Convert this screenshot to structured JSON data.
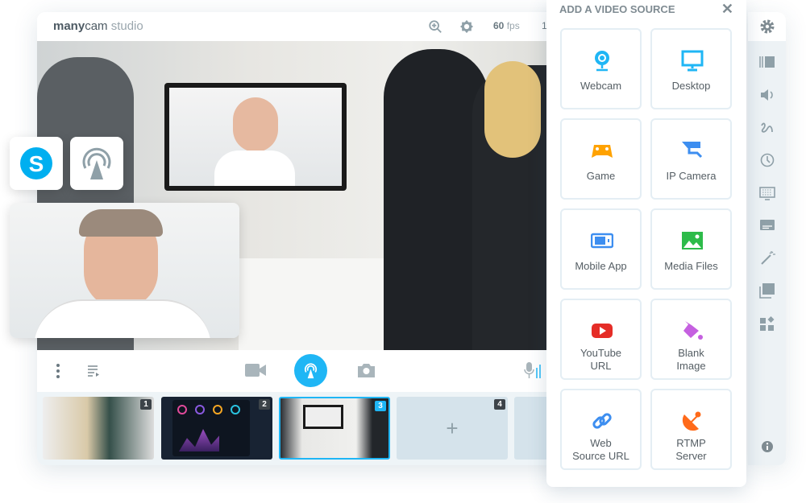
{
  "header": {
    "logo_bold": "many",
    "logo_mid": "cam",
    "logo_light": " studio",
    "fps_value": "60",
    "fps_unit": " fps",
    "resolution_partial": "1"
  },
  "panel": {
    "title": "ADD A VIDEO SOURCE",
    "close": "✕",
    "sources": [
      {
        "label": "Webcam",
        "icon": "webcam-icon",
        "color": "#1fb6f5"
      },
      {
        "label": "Desktop",
        "icon": "desktop-icon",
        "color": "#1fb6f5"
      },
      {
        "label": "Game",
        "icon": "gamepad-icon",
        "color": "#ffa200"
      },
      {
        "label": "IP Camera",
        "icon": "ip-camera-icon",
        "color": "#3d8ef0"
      },
      {
        "label": "Mobile App",
        "icon": "mobile-app-icon",
        "color": "#3d8ef0"
      },
      {
        "label": "Media Files",
        "icon": "image-icon",
        "color": "#2dbb4a"
      },
      {
        "label": "YouTube\nURL",
        "l1": "YouTube",
        "l2": "URL",
        "icon": "youtube-icon",
        "color": "#e52d27"
      },
      {
        "label": "Blank\nImage",
        "l1": "Blank",
        "l2": "Image",
        "icon": "paint-bucket-icon",
        "color": "#c560e0"
      },
      {
        "label": "Web\nSource URL",
        "l1": "Web",
        "l2": "Source URL",
        "icon": "link-icon",
        "color": "#3d8ef0"
      },
      {
        "label": "RTMP\nServer",
        "l1": "RTMP",
        "l2": "Server",
        "icon": "satellite-dish-icon",
        "color": "#ff6a1a"
      }
    ]
  },
  "thumbnails": [
    {
      "number": "1"
    },
    {
      "number": "2"
    },
    {
      "number": "3",
      "active": true
    },
    {
      "number": "4",
      "add": "+"
    }
  ],
  "colors": {
    "accent": "#1fb6f5",
    "icon_gray": "#8fa0a8"
  }
}
